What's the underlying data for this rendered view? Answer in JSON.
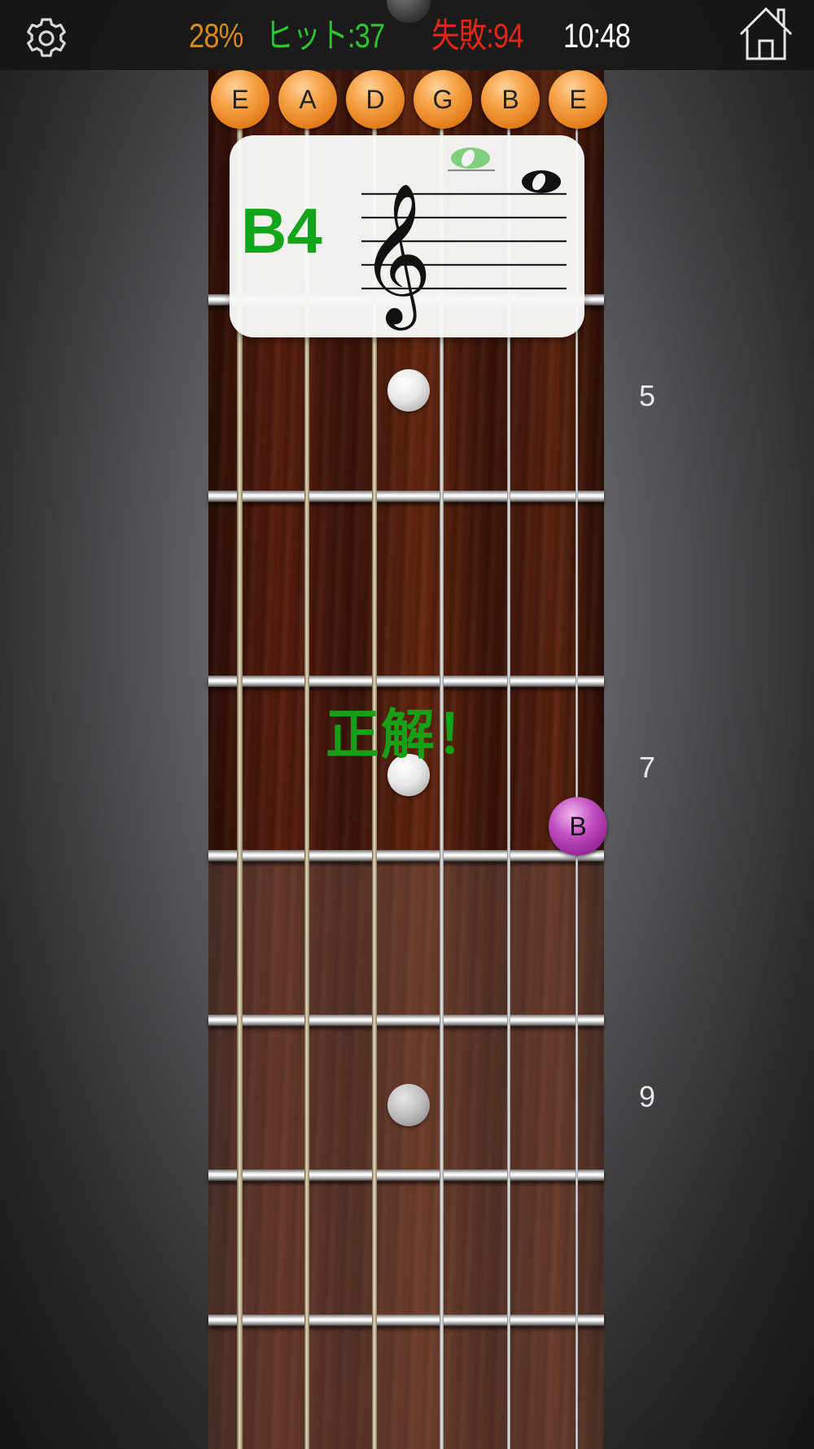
{
  "status": {
    "accuracy": "28%",
    "hits": "ヒット:37",
    "misses": "失敗:94",
    "time": "10:48"
  },
  "icons": {
    "settings": "gear-icon",
    "home": "home-icon"
  },
  "open_strings": [
    "E",
    "A",
    "D",
    "G",
    "B",
    "E"
  ],
  "note_card": {
    "note": "B4"
  },
  "fret_numbers": {
    "fret5": "5",
    "fret7": "7",
    "fret9": "9"
  },
  "feedback": "正解！",
  "answer_marker": {
    "label": "B"
  },
  "colors": {
    "accuracy": "#d68a1a",
    "hits": "#2ec430",
    "misses": "#e22618",
    "note_name": "#12a51a",
    "open_button": "#f7a44a",
    "answer_marker": "#c14ec0"
  }
}
